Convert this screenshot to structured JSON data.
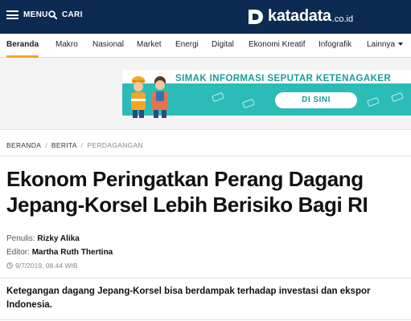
{
  "header": {
    "menu_label": "MENU",
    "search_label": "CARI",
    "logo_text": "katadata",
    "logo_suffix": ".co.id",
    "bg_color": "#0d2a52"
  },
  "nav": {
    "items": [
      {
        "label": "Beranda",
        "active": true
      },
      {
        "label": "Makro"
      },
      {
        "label": "Nasional"
      },
      {
        "label": "Market"
      },
      {
        "label": "Energi"
      },
      {
        "label": "Digital"
      },
      {
        "label": "Ekonomi Kreatif"
      },
      {
        "label": "Infografik"
      },
      {
        "label": "Lainnya",
        "has_dropdown": true
      }
    ],
    "accent_color": "#f5a623"
  },
  "ad": {
    "headline": "SIMAK INFORMASI SEPUTAR KETENAGAKER",
    "cta": "DI SINI",
    "color": "#2bbcb8"
  },
  "breadcrumb": {
    "items": [
      "BERANDA",
      "BERITA",
      "PERDAGANGAN"
    ]
  },
  "article": {
    "title_line1": "Ekonom Peringatkan Perang Dagang",
    "title_line2": "Jepang-Korsel Lebih Berisiko Bagi RI",
    "writer_prefix": "Penulis: ",
    "writer": "Rizky Alika",
    "editor_prefix": "Editor: ",
    "editor": "Martha Ruth Thertina",
    "date": "9/7/2019, 08.44 WIB",
    "lead": "Ketegangan dagang Jepang-Korsel bisa berdampak terhadap investasi dan ekspor Indonesia."
  }
}
